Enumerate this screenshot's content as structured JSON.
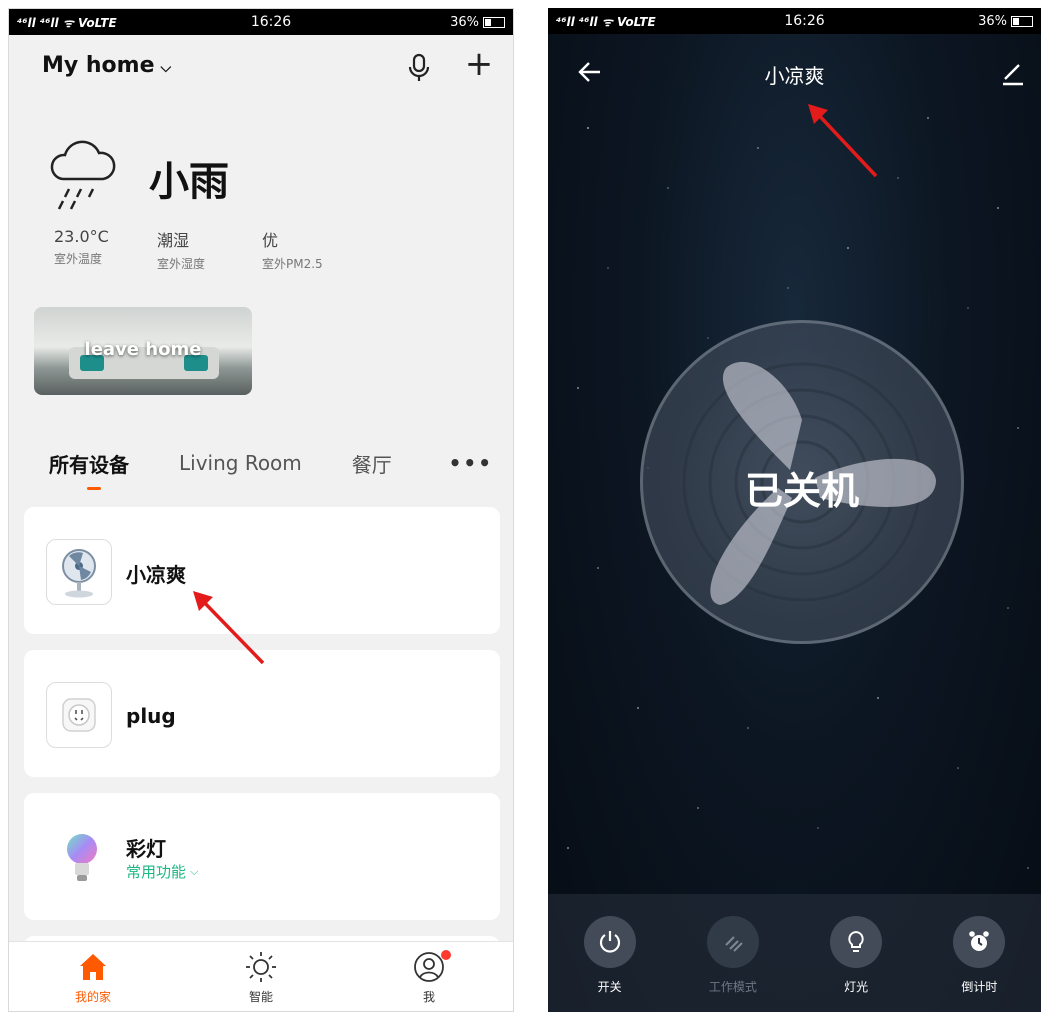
{
  "left_screen": {
    "status_bar": {
      "signal": "⁴⁶ll ⁴⁶ll ᯤ VoLTE",
      "time": "16:26",
      "battery": "36%"
    },
    "header": {
      "title": "My home"
    },
    "weather": {
      "condition": "小雨",
      "stats": [
        {
          "value": "23.0°C",
          "label": "室外温度"
        },
        {
          "value": "潮湿",
          "label": "室外湿度"
        },
        {
          "value": "优",
          "label": "室外PM2.5"
        }
      ]
    },
    "scene": {
      "label": "leave home"
    },
    "tabs": [
      {
        "label": "所有设备",
        "active": true
      },
      {
        "label": "Living Room",
        "active": false
      },
      {
        "label": "餐厅",
        "active": false
      }
    ],
    "devices": [
      {
        "name": "小凉爽",
        "subtitle": ""
      },
      {
        "name": "plug",
        "subtitle": ""
      },
      {
        "name": "彩灯",
        "subtitle": "常用功能"
      }
    ],
    "bottom_nav": [
      {
        "label": "我的家",
        "icon": "home-icon",
        "active": true
      },
      {
        "label": "智能",
        "icon": "sun-icon",
        "active": false
      },
      {
        "label": "我",
        "icon": "profile-icon",
        "active": false
      }
    ],
    "colors": {
      "accent": "#ff5a00",
      "green": "#1cb883",
      "background": "#f1f1f1"
    }
  },
  "right_screen": {
    "status_bar": {
      "signal": "⁴⁶ll ⁴⁶ll ᯤ VoLTE",
      "time": "16:26",
      "battery": "36%"
    },
    "header": {
      "title": "小凉爽"
    },
    "fan_status": "已关机",
    "controls": [
      {
        "label": "开关",
        "icon": "power-icon",
        "enabled": true
      },
      {
        "label": "工作模式",
        "icon": "mode-icon",
        "enabled": false
      },
      {
        "label": "灯光",
        "icon": "bulb-icon",
        "enabled": true
      },
      {
        "label": "倒计时",
        "icon": "alarm-icon",
        "enabled": true
      }
    ]
  }
}
